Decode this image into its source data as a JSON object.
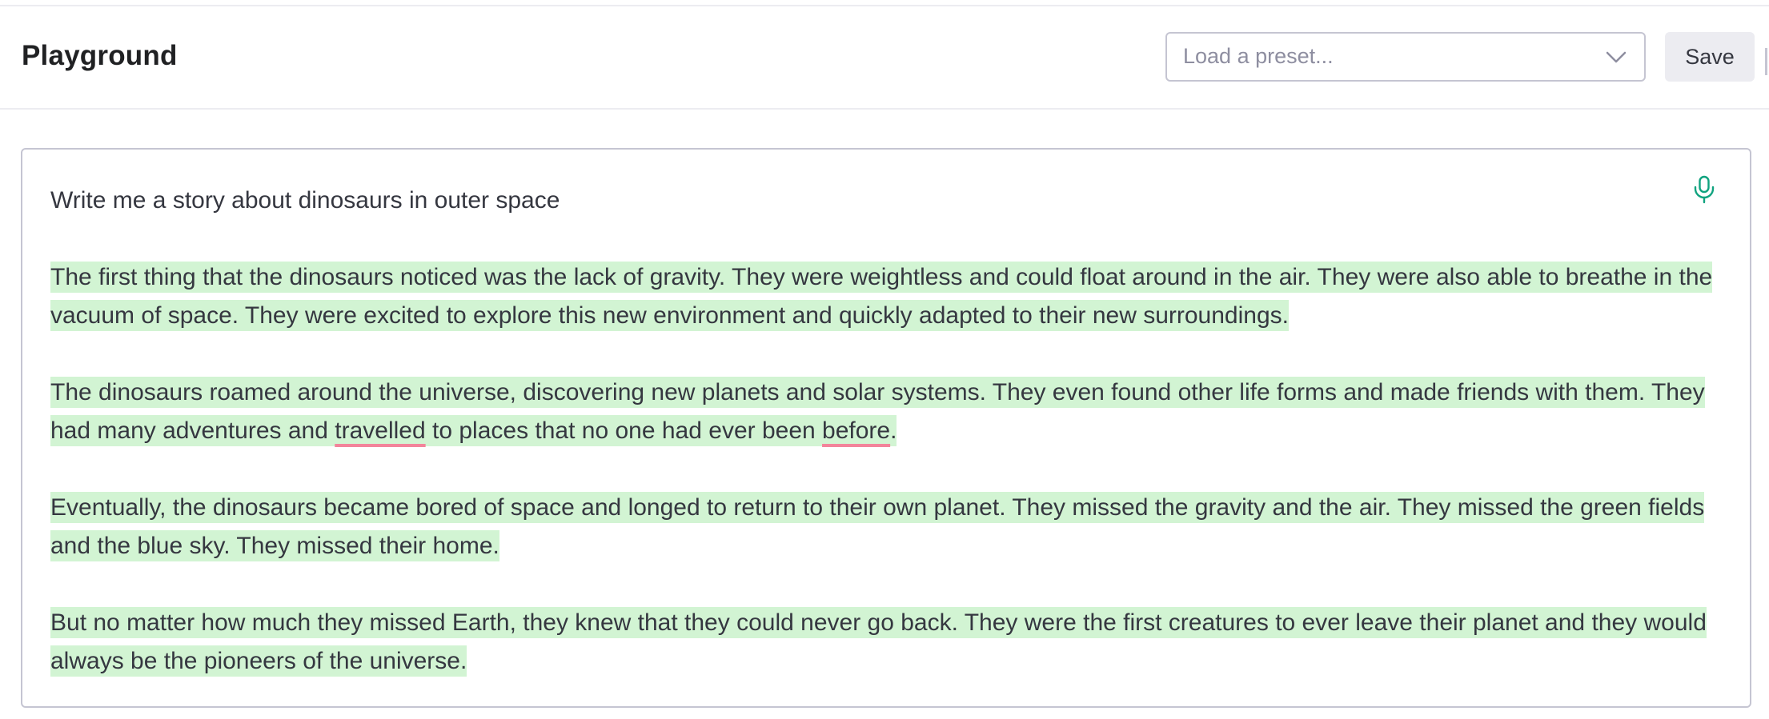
{
  "header": {
    "title": "Playground",
    "preset_placeholder": "Load a preset...",
    "save_label": "Save"
  },
  "editor": {
    "prompt": "Write me a story about dinosaurs in outer space",
    "mic_icon": "microphone-icon",
    "paragraphs": [
      {
        "text": "The first thing that the dinosaurs noticed was the lack of gravity. They were weightless and could float around in the air. They were also able to breathe in the vacuum of space. They were excited to explore this new environment and quickly adapted to their new surroundings."
      },
      {
        "a": "The dinosaurs roamed around the universe, discovering new planets and solar systems. They even found other life forms and made friends with them. They had many adventures and ",
        "b": "travelled",
        "c": " to places that no one had ever been ",
        "d": "before",
        "e": "."
      },
      {
        "text": "Eventually, the dinosaurs became bored of space and longed to return to their own planet. They missed the gravity and the air. They missed the green fields and the blue sky. They missed their home."
      },
      {
        "text": "But no matter how much they missed Earth, they knew that they could never go back. They were the first creatures to ever leave their planet and they would always be the pioneers of the universe."
      }
    ]
  },
  "colors": {
    "completion_highlight": "#d2f4d3",
    "accent_green": "#10a37f",
    "spellcheck_underline": "#f3849b",
    "text": "#353740"
  }
}
